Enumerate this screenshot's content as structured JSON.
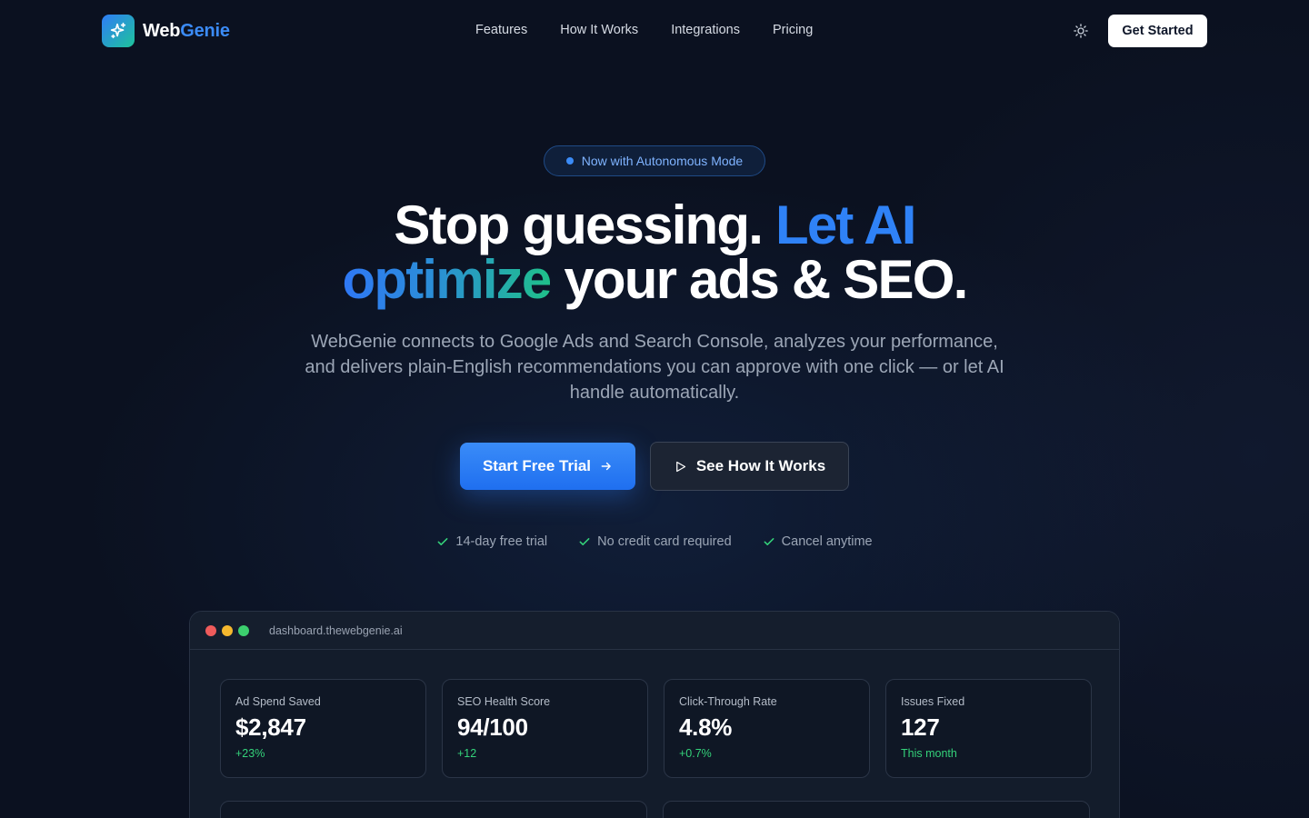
{
  "brand": {
    "name_part1": "Web",
    "name_part2": "Genie",
    "logo_icon": "sparkles-icon"
  },
  "nav": {
    "links": [
      "Features",
      "How It Works",
      "Integrations",
      "Pricing"
    ],
    "theme_toggle_icon": "sun-icon",
    "cta_label": "Get Started"
  },
  "hero": {
    "badge": "Now with Autonomous Mode",
    "headline_part1": "Stop guessing. ",
    "headline_highlight1": "Let AI",
    "headline_highlight2": "optimize",
    "headline_part2": " your ads & SEO.",
    "subtext": "WebGenie connects to Google Ads and Search Console, analyzes your performance, and delivers plain-English recommendations you can approve with one click — or let AI handle automatically.",
    "primary_button": "Start Free Trial",
    "secondary_button": "See How It Works",
    "perks": [
      "14-day free trial",
      "No credit card required",
      "Cancel anytime"
    ]
  },
  "preview": {
    "url": "dashboard.thewebgenie.ai",
    "stats": [
      {
        "label": "Ad Spend Saved",
        "value": "$2,847",
        "change": "+23%"
      },
      {
        "label": "SEO Health Score",
        "value": "94/100",
        "change": "+12"
      },
      {
        "label": "Click-Through Rate",
        "value": "4.8%",
        "change": "+0.7%"
      },
      {
        "label": "Issues Fixed",
        "value": "127",
        "change": "This month"
      }
    ]
  },
  "colors": {
    "background": "#0b1120",
    "accent_blue": "#2f82f7",
    "accent_green": "#1fc08a",
    "positive": "#34d27a"
  }
}
